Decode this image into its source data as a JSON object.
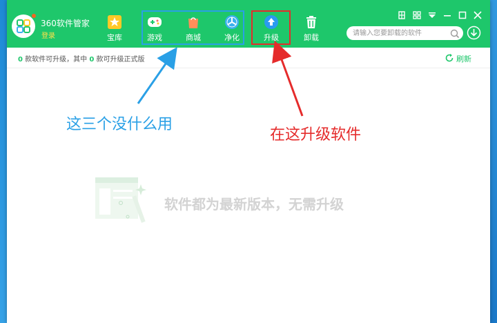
{
  "app": {
    "name": "360软件管家",
    "login_label": "登录"
  },
  "nav": {
    "items": [
      {
        "id": "baoku",
        "label": "宝库",
        "icon": "star-icon",
        "color": "#ffc926"
      },
      {
        "id": "games",
        "label": "游戏",
        "icon": "gamepad-icon",
        "color": "#ffffff"
      },
      {
        "id": "store",
        "label": "商城",
        "icon": "shopping-bag-icon",
        "color": "#ff8e5a"
      },
      {
        "id": "clean",
        "label": "净化",
        "icon": "fan-icon",
        "color": "#3ab0ee"
      },
      {
        "id": "upgrade",
        "label": "升级",
        "icon": "upgrade-arrow-icon",
        "color": "#2a9af0"
      },
      {
        "id": "uninstall",
        "label": "卸载",
        "icon": "trash-icon",
        "color": "#ffffff"
      }
    ]
  },
  "window_controls": [
    "grid-icon",
    "apps-icon",
    "dropdown-icon",
    "minimize-icon",
    "maximize-icon",
    "close-icon"
  ],
  "search": {
    "placeholder": "请输入您要卸载的软件",
    "value": ""
  },
  "status": {
    "count_upgradable": "0",
    "text_part1": "款软件可升级，其中",
    "count_official": "0",
    "text_part2": "款可升级正式版",
    "refresh_label": "刷新"
  },
  "annotations": {
    "blue_note": "这三个没什么用",
    "red_note": "在这升级软件"
  },
  "empty_state": {
    "message": "软件都为最新版本，无需升级"
  },
  "colors": {
    "title_bar": "#1ec76b",
    "accent_green": "#1ec76b",
    "annotation_blue": "#2aa0e6",
    "annotation_red": "#e52b2b",
    "login_yellow": "#ffe14a"
  }
}
